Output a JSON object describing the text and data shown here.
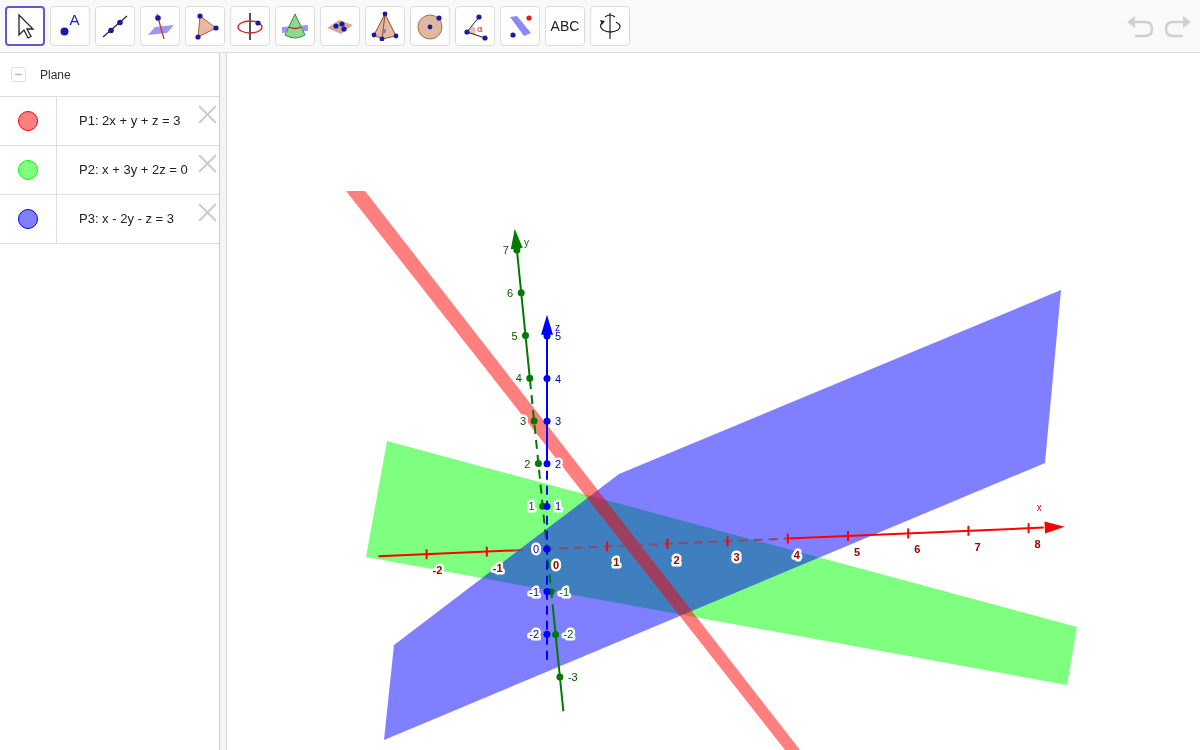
{
  "toolbar": {
    "tools": [
      {
        "kind": "move",
        "selected": true
      },
      {
        "kind": "point",
        "selected": false,
        "label": "A"
      },
      {
        "kind": "line",
        "selected": false
      },
      {
        "kind": "perpendicular",
        "selected": false
      },
      {
        "kind": "polygon",
        "selected": false
      },
      {
        "kind": "circle-axis",
        "selected": false
      },
      {
        "kind": "intersect",
        "selected": false
      },
      {
        "kind": "plane",
        "selected": false
      },
      {
        "kind": "pyramid",
        "selected": false
      },
      {
        "kind": "sphere",
        "selected": false
      },
      {
        "kind": "angle",
        "selected": false,
        "label": "α"
      },
      {
        "kind": "reflect",
        "selected": false
      },
      {
        "kind": "text",
        "selected": false,
        "label": "ABC"
      },
      {
        "kind": "rotate",
        "selected": false
      }
    ],
    "history": [
      {
        "kind": "undo",
        "disabled": true
      },
      {
        "kind": "redo",
        "disabled": true
      }
    ]
  },
  "algebra": {
    "group": {
      "label": "Plane",
      "expanded": true
    },
    "items": [
      {
        "label": "P1: 2x + y + z = 3",
        "color": "#ff8080"
      },
      {
        "label": "P2: x + 3y + 2z = 0",
        "color": "#80ff80"
      },
      {
        "label": "P3: x - 2y - z = 3",
        "color": "#8080ff"
      }
    ]
  },
  "graphics": {
    "axes": [
      {
        "name": "x",
        "ticks": [
          "-2",
          "-1",
          "0",
          "1",
          "2",
          "3",
          "4",
          "5",
          "6",
          "7",
          "8"
        ]
      },
      {
        "name": "y",
        "ticks": [
          "7",
          "6",
          "5",
          "4",
          "3",
          "2",
          "1",
          "-1",
          "-2",
          "-3"
        ]
      },
      {
        "name": "z",
        "ticks": [
          "5",
          "4",
          "3",
          "2",
          "1",
          "0",
          "-1",
          "-2"
        ]
      }
    ]
  }
}
